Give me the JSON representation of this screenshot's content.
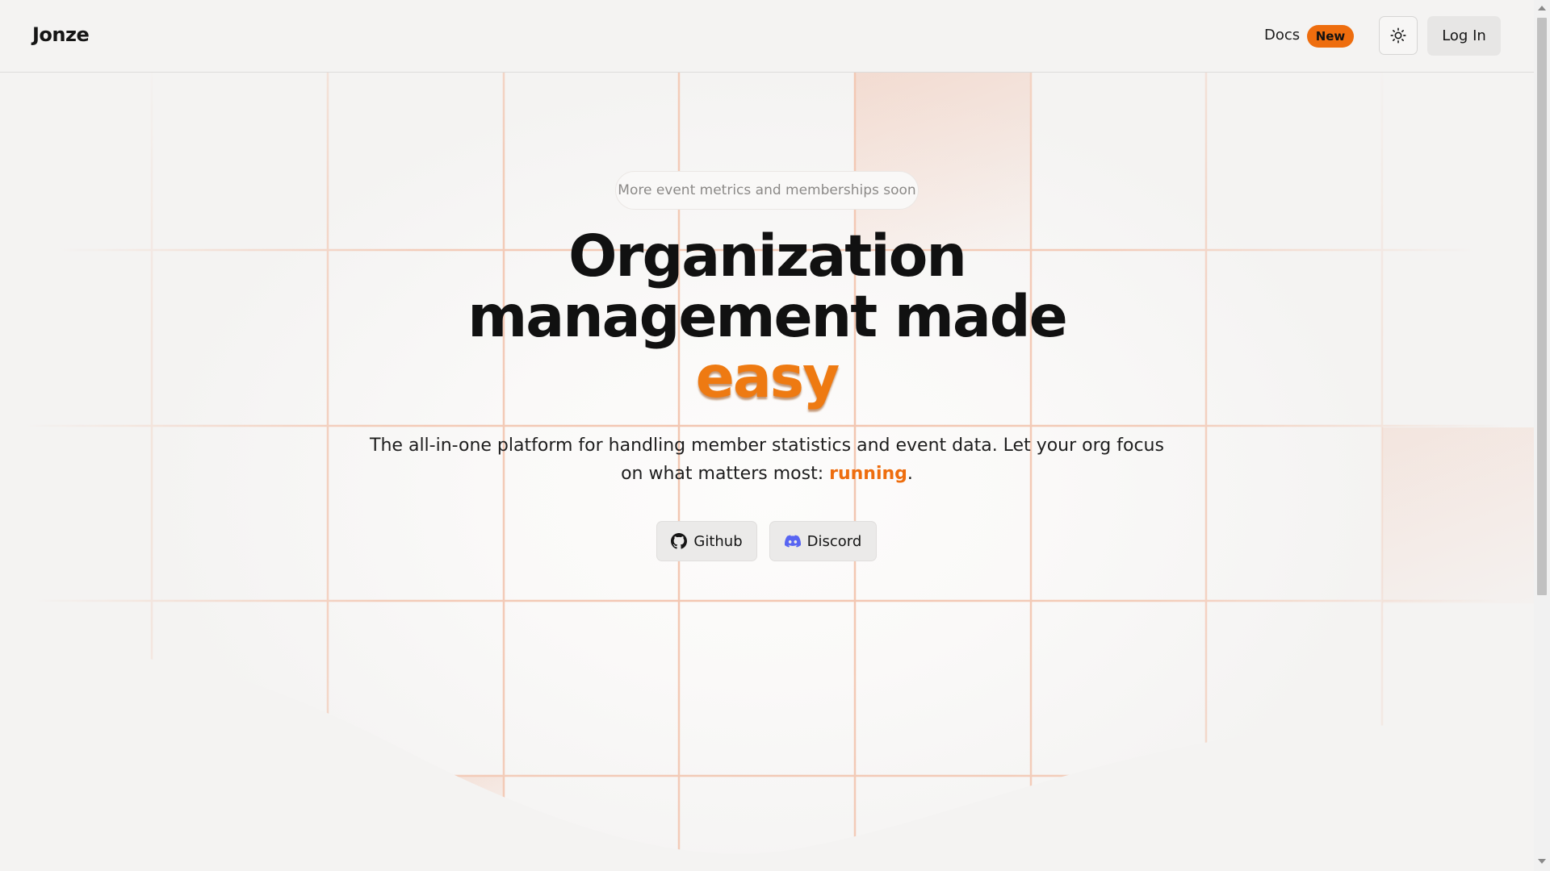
{
  "header": {
    "brand": "Jonze",
    "docs_label": "Docs",
    "docs_badge": "New",
    "theme_toggle_icon": "sun-icon",
    "login_label": "Log In"
  },
  "hero": {
    "announcement": "More event metrics and memberships soon",
    "headline_line1": "Organization",
    "headline_line2": "management made",
    "headline_accent": "easy",
    "subtext_line1": "The all-in-one platform for handling member statistics and event data. Let your org focus",
    "subtext_line2_prefix": "on what matters most: ",
    "subtext_accent": "running",
    "subtext_suffix": ".",
    "buttons": [
      {
        "label": "Github",
        "icon": "github-icon"
      },
      {
        "label": "Discord",
        "icon": "discord-icon"
      }
    ]
  },
  "colors": {
    "accent": "#ee6d0e",
    "background": "#f4f3f2",
    "grid_line": "#f2c4ae",
    "discord": "#5865f2"
  }
}
